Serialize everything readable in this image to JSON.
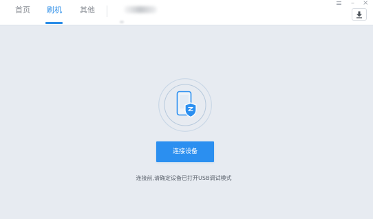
{
  "tabs": {
    "home": "首页",
    "flash": "刷机",
    "other": "其他"
  },
  "window": {
    "minimize_symbol": "–",
    "close_symbol": "×"
  },
  "main": {
    "connect_button": "连接设备",
    "hint_text": "连接前,请确定设备已打开USB调试模式"
  },
  "icons": {
    "device": "phone-shield-icon",
    "download": "download-icon",
    "menu": "menu-icon"
  },
  "colors": {
    "accent": "#2b8de8",
    "button": "#2b8ff0",
    "background": "#e7ebf1"
  }
}
